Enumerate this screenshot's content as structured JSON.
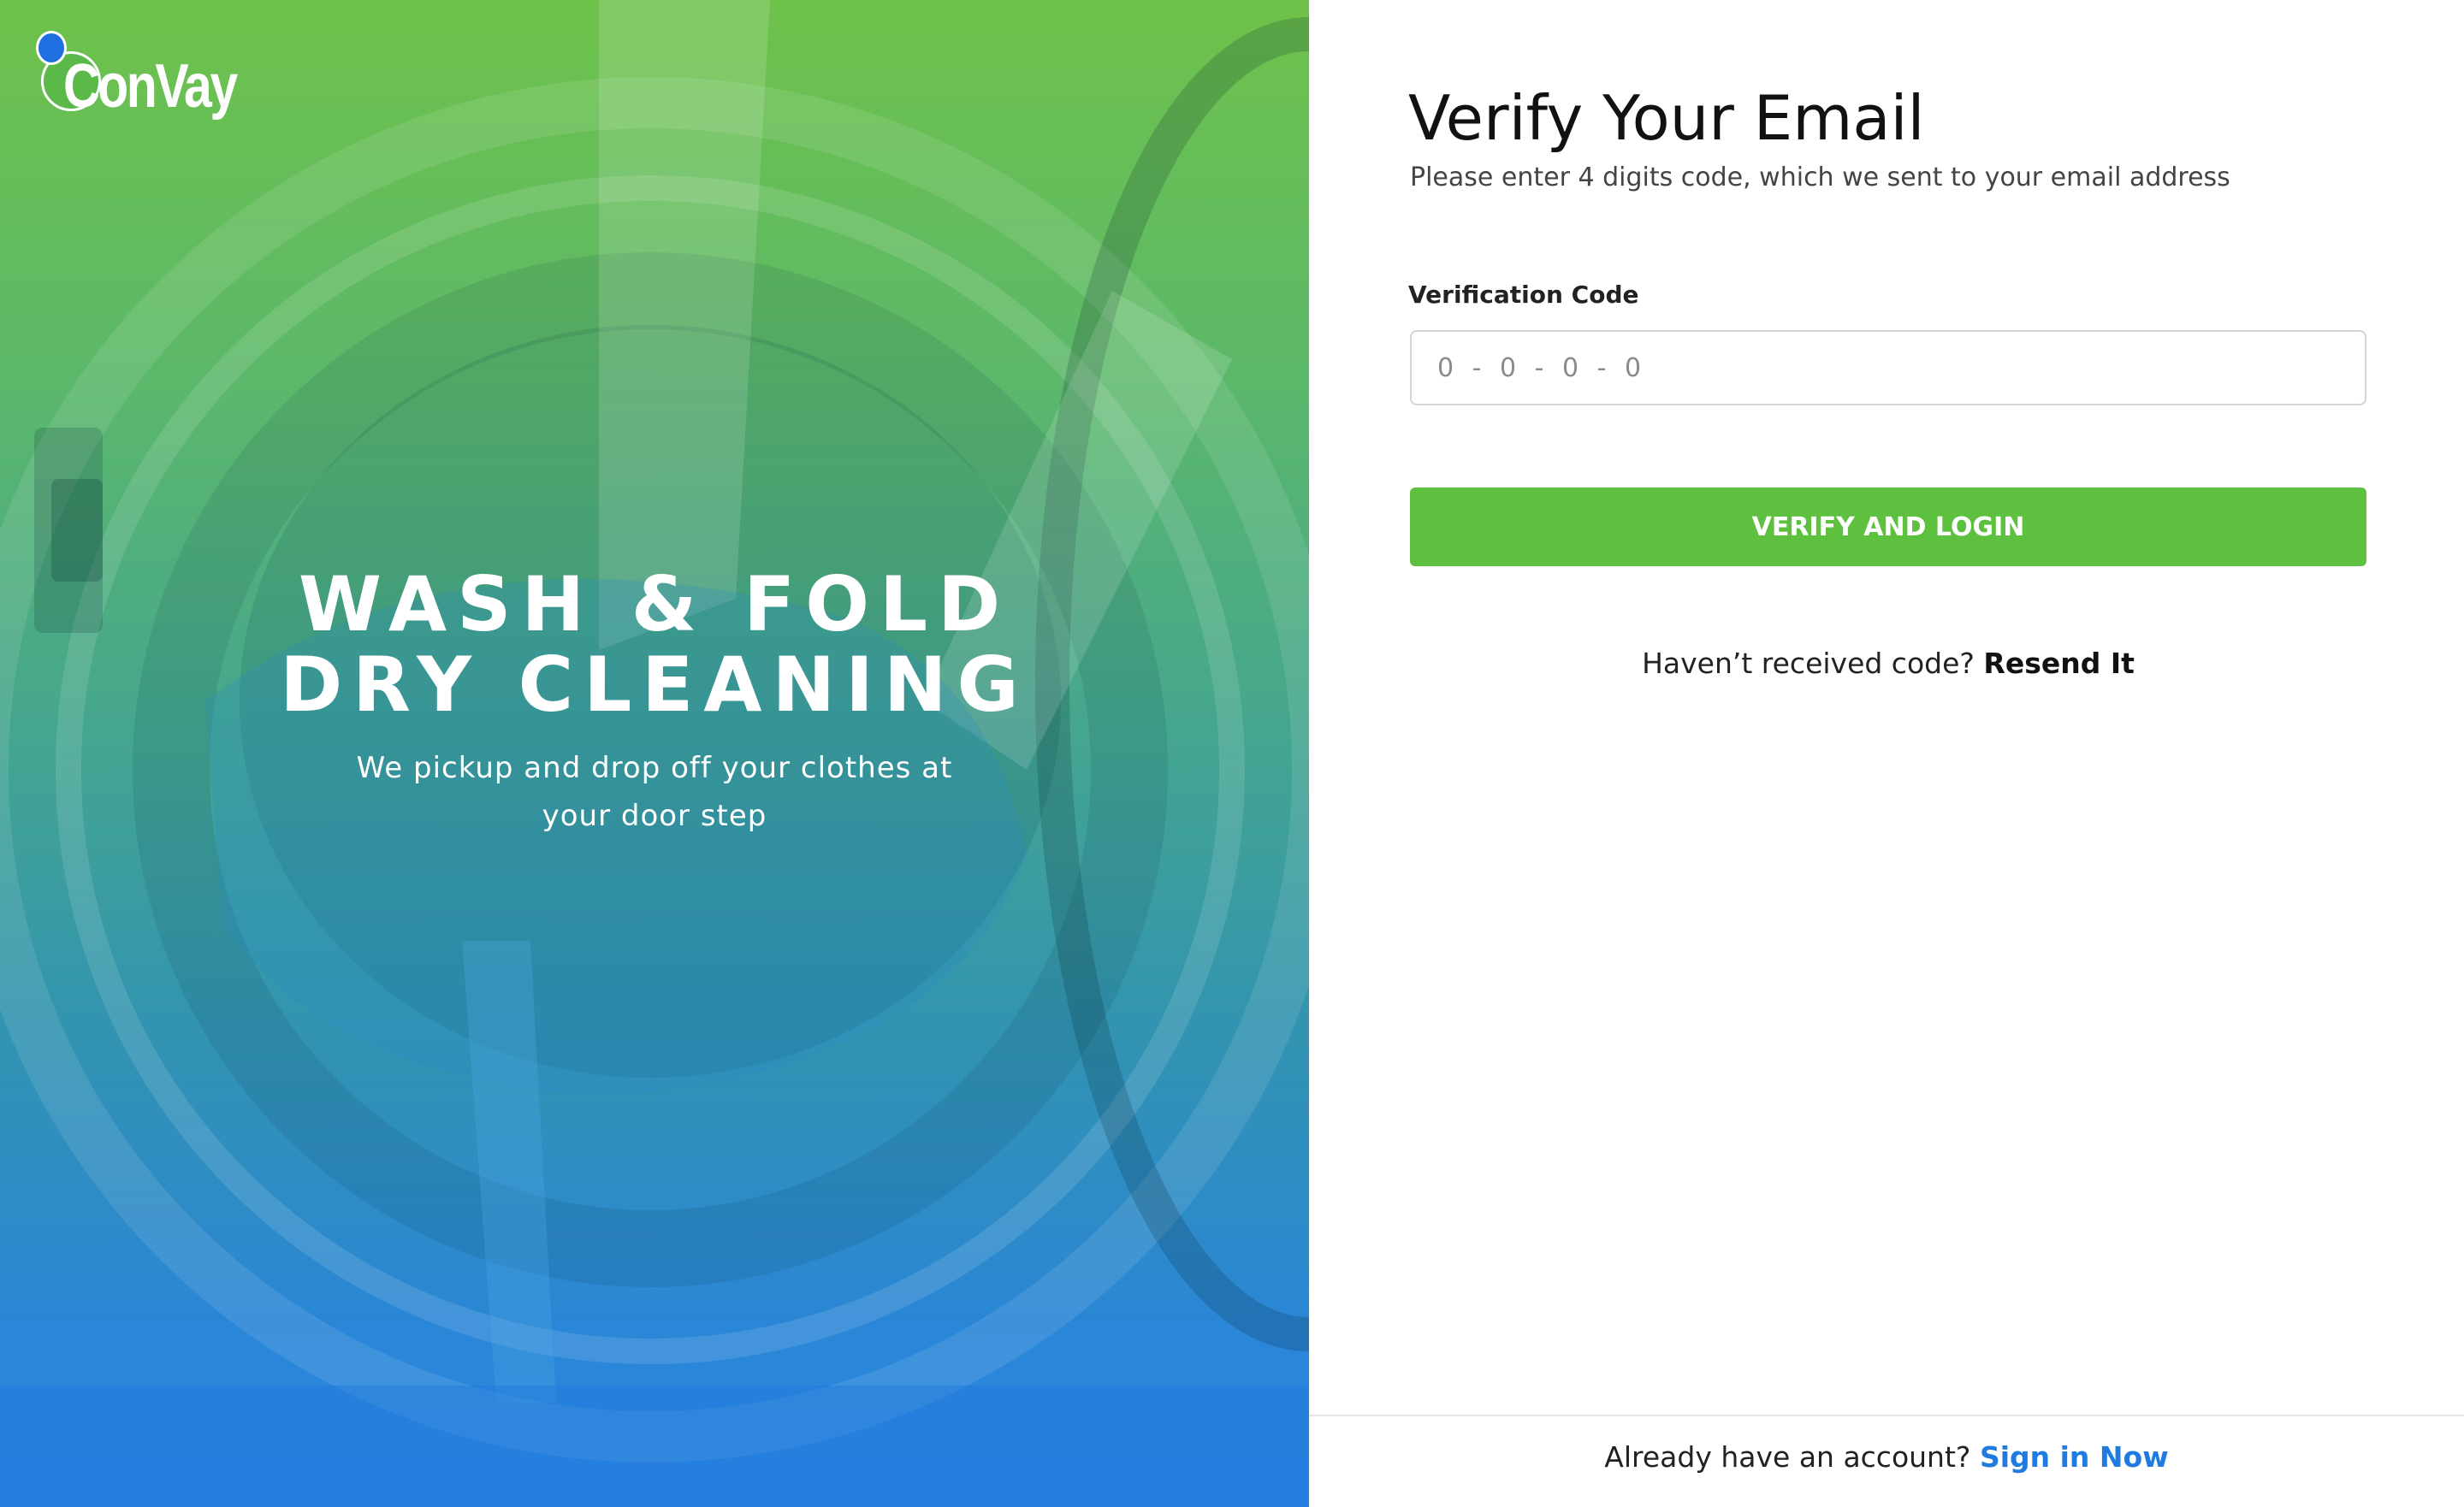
{
  "brand": {
    "name": "ConVay"
  },
  "hero": {
    "headline_line1": "WASH & FOLD",
    "headline_line2": "DRY CLEANING",
    "subtitle": "We pickup and drop off your clothes at your door step"
  },
  "form": {
    "title": "Verify Your Email",
    "subtitle": "Please enter 4 digits code, which we sent to your email address",
    "code_label": "Verification Code",
    "code_placeholder": "0 - 0 - 0 - 0",
    "code_value": "",
    "submit_label": "VERIFY AND LOGIN",
    "resend_prompt": "Haven’t received code?",
    "resend_link": "Resend It"
  },
  "footer": {
    "prompt": "Already have an account?",
    "link": "Sign in Now"
  },
  "colors": {
    "primary_green": "#5dc13f",
    "link_blue": "#1f7be0",
    "hero_top": "#6ec24a",
    "hero_bottom": "#2b86e3"
  }
}
